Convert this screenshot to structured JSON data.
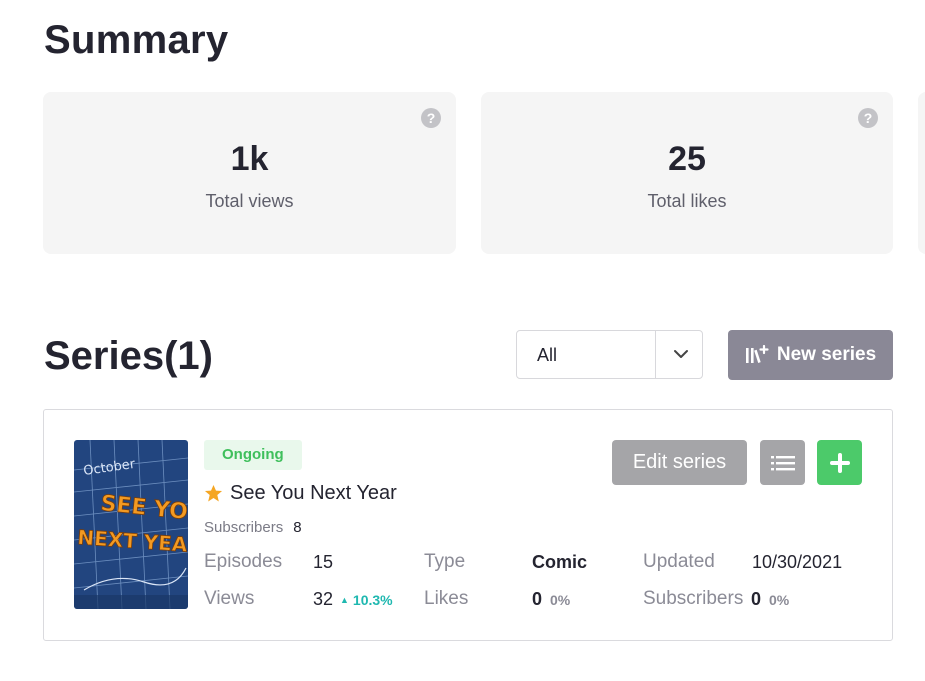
{
  "summary": {
    "title": "Summary",
    "cards": [
      {
        "value": "1k",
        "label": "Total views"
      },
      {
        "value": "25",
        "label": "Total likes"
      }
    ]
  },
  "series_section": {
    "title": "Series(1)",
    "filter": {
      "selected": "All"
    },
    "new_series_label": "New series"
  },
  "series": [
    {
      "status": "Ongoing",
      "name": "See You Next Year",
      "cover_text": {
        "month": "October",
        "line1": "SEE YOU",
        "line2": "NEXT YEAR"
      },
      "subscribers_label": "Subscribers",
      "subscribers_value": "8",
      "stats": {
        "episodes_label": "Episodes",
        "episodes_value": "15",
        "type_label": "Type",
        "type_value": "Comic",
        "updated_label": "Updated",
        "updated_value": "10/30/2021",
        "views_label": "Views",
        "views_value": "32",
        "views_delta": "10.3%",
        "likes_label": "Likes",
        "likes_value": "0",
        "likes_pct": "0%",
        "subs_label": "Subscribers",
        "subs_value": "0",
        "subs_pct": "0%"
      },
      "edit_label": "Edit series"
    }
  ],
  "colors": {
    "status_green": "#3fbf5c",
    "add_button": "#4cca6a",
    "delta_teal": "#1fb8b0",
    "button_gray": "#a5a5a8",
    "new_series_gray": "#8a8896",
    "star": "#f5a623"
  },
  "icons": [
    "help-icon",
    "chevron-down-icon",
    "library-icon",
    "star-icon",
    "list-icon",
    "plus-icon"
  ]
}
